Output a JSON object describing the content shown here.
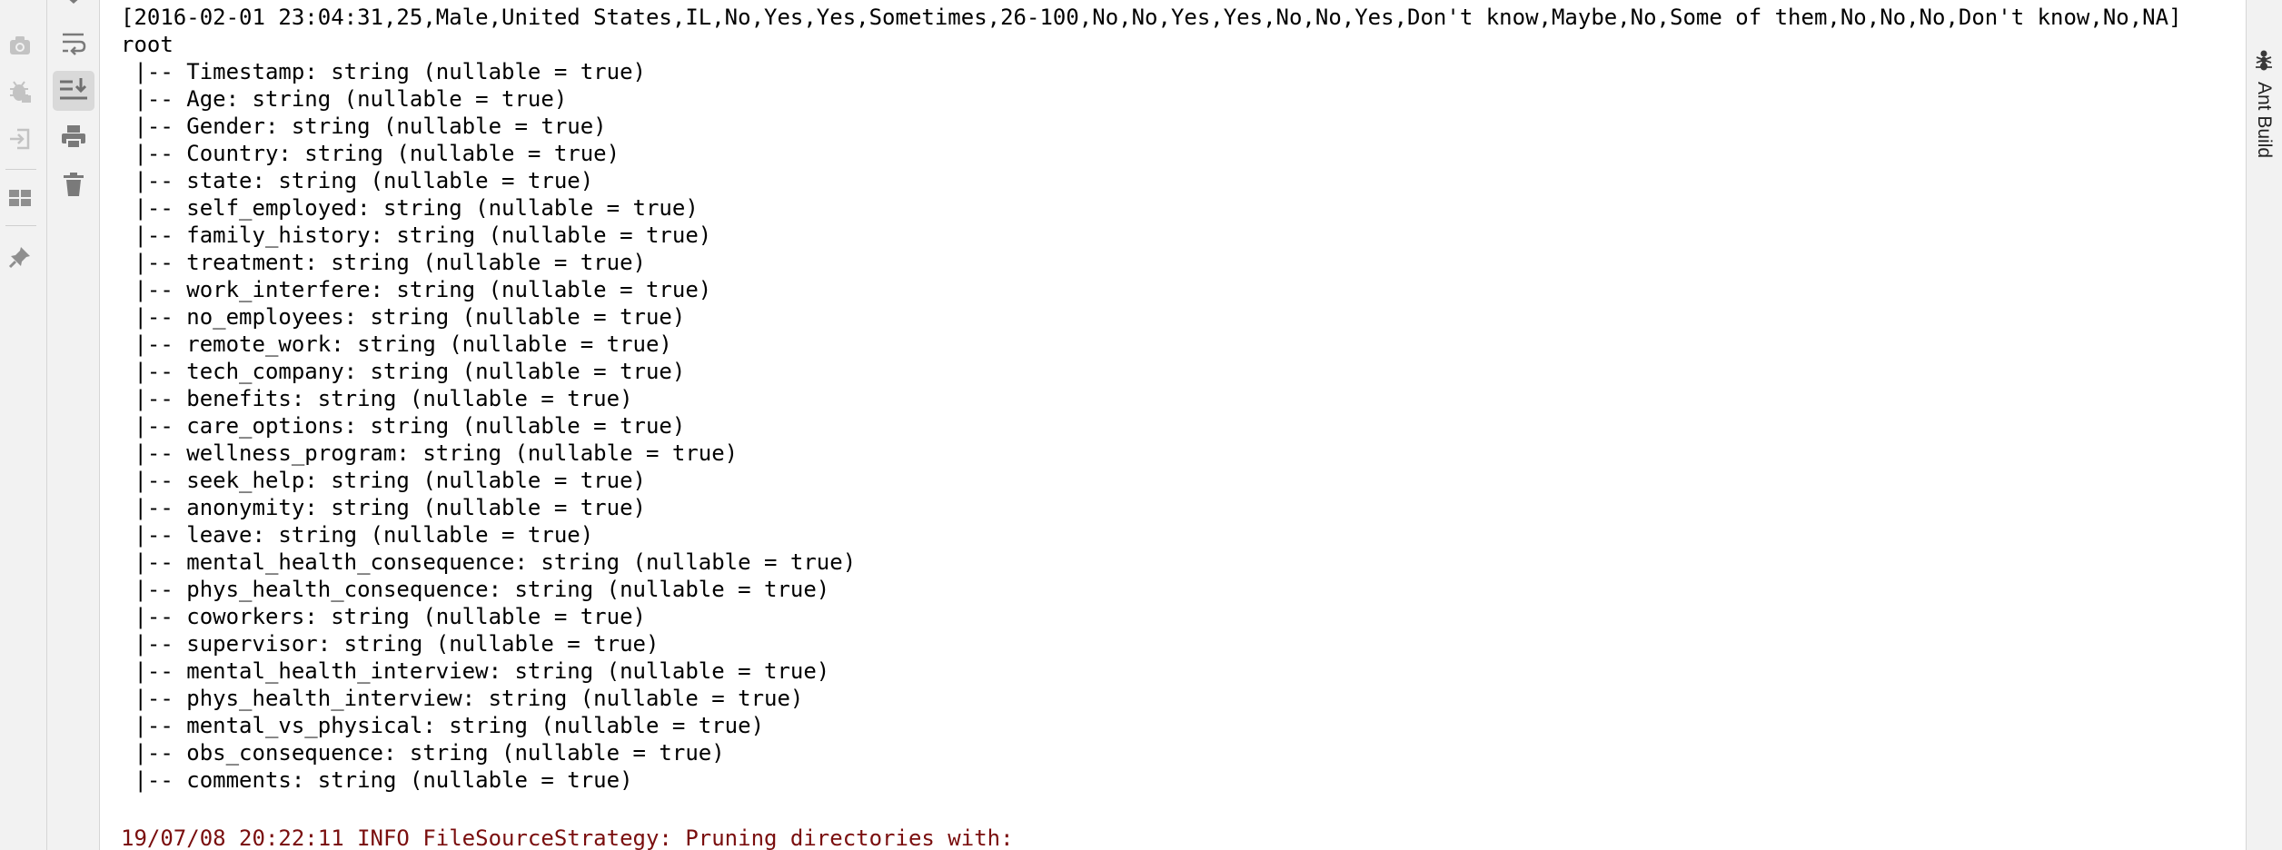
{
  "left_toolbar": {
    "icons": [
      "camera-icon",
      "debug-icon",
      "login-icon",
      "layout-icon",
      "pin-icon"
    ]
  },
  "console_toolbar": {
    "icons": [
      "soft-wrap-icon",
      "scroll-to-end-icon",
      "print-icon",
      "trash-icon"
    ]
  },
  "right_sidebar": {
    "ant_build_label": "Ant Build",
    "cut_label": "n"
  },
  "console": {
    "lines": [
      "[2016-02-01 23:04:31,25,Male,United States,IL,No,Yes,Yes,Sometimes,26-100,No,No,Yes,Yes,No,No,Yes,Don't know,Maybe,No,Some of them,No,No,No,Don't know,No,NA]",
      "root",
      " |-- Timestamp: string (nullable = true)",
      " |-- Age: string (nullable = true)",
      " |-- Gender: string (nullable = true)",
      " |-- Country: string (nullable = true)",
      " |-- state: string (nullable = true)",
      " |-- self_employed: string (nullable = true)",
      " |-- family_history: string (nullable = true)",
      " |-- treatment: string (nullable = true)",
      " |-- work_interfere: string (nullable = true)",
      " |-- no_employees: string (nullable = true)",
      " |-- remote_work: string (nullable = true)",
      " |-- tech_company: string (nullable = true)",
      " |-- benefits: string (nullable = true)",
      " |-- care_options: string (nullable = true)",
      " |-- wellness_program: string (nullable = true)",
      " |-- seek_help: string (nullable = true)",
      " |-- anonymity: string (nullable = true)",
      " |-- leave: string (nullable = true)",
      " |-- mental_health_consequence: string (nullable = true)",
      " |-- phys_health_consequence: string (nullable = true)",
      " |-- coworkers: string (nullable = true)",
      " |-- supervisor: string (nullable = true)",
      " |-- mental_health_interview: string (nullable = true)",
      " |-- phys_health_interview: string (nullable = true)",
      " |-- mental_vs_physical: string (nullable = true)",
      " |-- obs_consequence: string (nullable = true)",
      " |-- comments: string (nullable = true)",
      "",
      "19/07/08 20:22:11 INFO FileSourceStrategy: Pruning directories with:"
    ]
  },
  "colors": {
    "log_text": "#7a0e0e",
    "stdout_text": "#000000",
    "toolbar_bg": "#f2f2f2"
  }
}
